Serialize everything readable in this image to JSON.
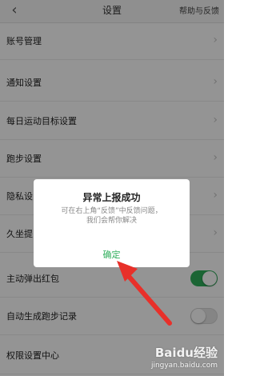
{
  "header": {
    "back_icon": "chevron-left-icon",
    "title": "设置",
    "help_label": "帮助与反馈"
  },
  "settings": [
    {
      "label": "账号管理",
      "control": "chevron"
    },
    {
      "label": "通知设置",
      "control": "chevron"
    },
    {
      "label": "每日运动目标设置",
      "control": "chevron"
    },
    {
      "label": "跑步设置",
      "control": "chevron"
    },
    {
      "label": "隐私设",
      "control": "chevron"
    },
    {
      "label": "久坐提",
      "control": "chevron"
    },
    {
      "label": "主动弹出红包",
      "control": "toggle",
      "toggle_on": true
    },
    {
      "label": "自动生成跑步记录",
      "control": "toggle",
      "toggle_on": false
    },
    {
      "label": "权限设置中心",
      "control": "chevron"
    }
  ],
  "dialog": {
    "title": "异常上报成功",
    "message_line1": "可在右上角“反馈”中反馈问题，",
    "message_line2": "我们会帮你解决",
    "confirm_label": "确定"
  },
  "watermark": {
    "logo": "Baidu经验",
    "url": "jingyan.baidu.com"
  },
  "colors": {
    "accent_green": "#2fae5b",
    "annotation_arrow": "#e8302a"
  }
}
